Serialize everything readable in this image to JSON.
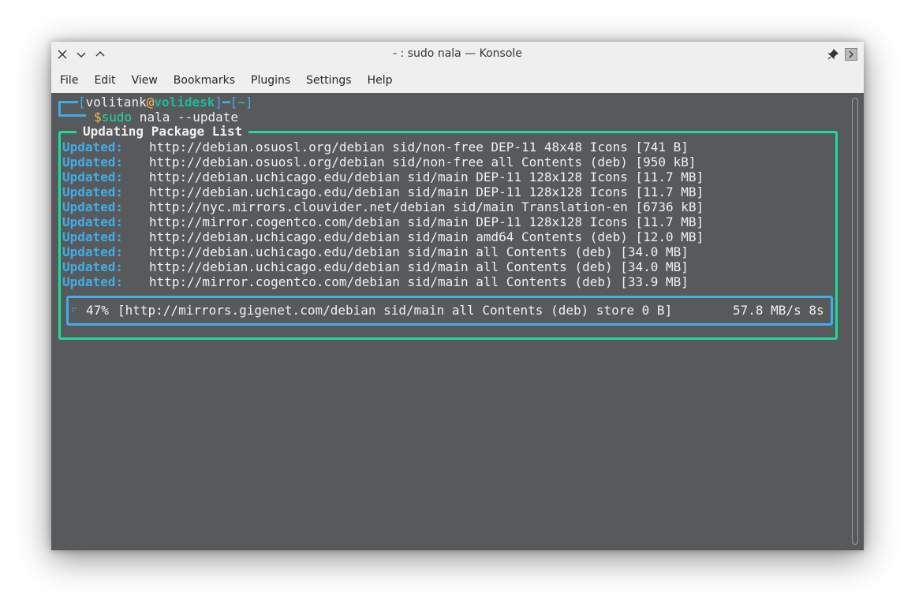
{
  "window": {
    "title": "- : sudo nala — Konsole",
    "buttons": {
      "close": "✕",
      "minimize": "⌄",
      "maximize": "⌃",
      "pin": "📌",
      "more": "›"
    }
  },
  "menubar": {
    "items": [
      "File",
      "Edit",
      "View",
      "Bookmarks",
      "Plugins",
      "Settings",
      "Help"
    ]
  },
  "prompt": {
    "user": "volitank",
    "at": "@",
    "host": "volidesk",
    "dir": "~",
    "dollar": "$",
    "command_sudo": "sudo",
    "command_rest": " nala --update"
  },
  "panel": {
    "title": "Updating Package List",
    "updates": [
      {
        "label": "Updated:",
        "text": "http://debian.osuosl.org/debian sid/non-free DEP-11 48x48 Icons [741 B]"
      },
      {
        "label": "Updated:",
        "text": "http://debian.osuosl.org/debian sid/non-free all Contents (deb) [950 kB]"
      },
      {
        "label": "Updated:",
        "text": "http://debian.uchicago.edu/debian sid/main DEP-11 128x128 Icons [11.7 MB]"
      },
      {
        "label": "Updated:",
        "text": "http://debian.uchicago.edu/debian sid/main DEP-11 128x128 Icons [11.7 MB]"
      },
      {
        "label": "Updated:",
        "text": "http://nyc.mirrors.clouvider.net/debian sid/main Translation-en [6736 kB]"
      },
      {
        "label": "Updated:",
        "text": "http://mirror.cogentco.com/debian sid/main DEP-11 128x128 Icons [11.7 MB]"
      },
      {
        "label": "Updated:",
        "text": "http://debian.uchicago.edu/debian sid/main amd64 Contents (deb) [12.0 MB]"
      },
      {
        "label": "Updated:",
        "text": "http://debian.uchicago.edu/debian sid/main all Contents (deb) [34.0 MB]"
      },
      {
        "label": "Updated:",
        "text": "http://debian.uchicago.edu/debian sid/main all Contents (deb) [34.0 MB]"
      },
      {
        "label": "Updated:",
        "text": "http://mirror.cogentco.com/debian sid/main all Contents (deb) [33.9 MB]"
      }
    ],
    "progress": {
      "spinner": "⠋",
      "percent": "47%",
      "text": "[http://mirrors.gigenet.com/debian sid/main all Contents (deb) store 0 B]",
      "speed": "57.8 MB/s 8s"
    }
  },
  "colors": {
    "panel_border": "#1cdc9a",
    "progress_border": "#3daee9",
    "label": "#3daee9",
    "terminal_bg": "#58595b"
  }
}
